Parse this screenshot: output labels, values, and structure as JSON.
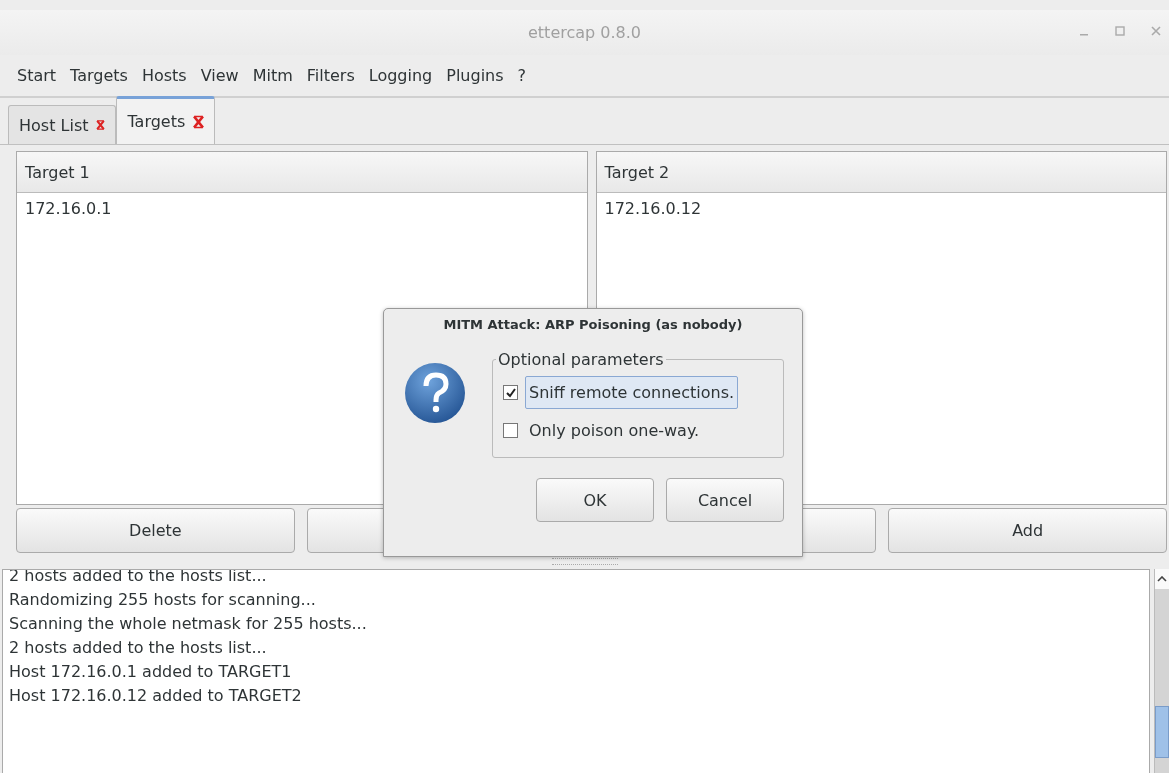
{
  "window": {
    "title": "ettercap 0.8.0"
  },
  "menu": [
    "Start",
    "Targets",
    "Hosts",
    "View",
    "Mitm",
    "Filters",
    "Logging",
    "Plugins",
    "?"
  ],
  "tabs": [
    {
      "label": "Host List",
      "selected": false
    },
    {
      "label": "Targets",
      "selected": true
    }
  ],
  "targets": [
    {
      "heading": "Target 1",
      "hosts": [
        "172.16.0.1"
      ]
    },
    {
      "heading": "Target 2",
      "hosts": [
        "172.16.0.12"
      ]
    }
  ],
  "buttons": {
    "left": "Delete",
    "right": "Add"
  },
  "dialog": {
    "title": "MITM Attack: ARP Poisoning (as nobody)",
    "group": "Optional parameters",
    "options": [
      {
        "label": "Sniff remote connections.",
        "checked": true,
        "focused": true
      },
      {
        "label": "Only poison one-way.",
        "checked": false,
        "focused": false
      }
    ],
    "buttons": [
      "OK",
      "Cancel"
    ]
  },
  "log": [
    "2 hosts added to the hosts list...",
    "Randomizing 255 hosts for scanning...",
    "Scanning the whole netmask for 255 hosts...",
    "2 hosts added to the hosts list...",
    "Host 172.16.0.1 added to TARGET1",
    "Host 172.16.0.12 added to TARGET2"
  ]
}
